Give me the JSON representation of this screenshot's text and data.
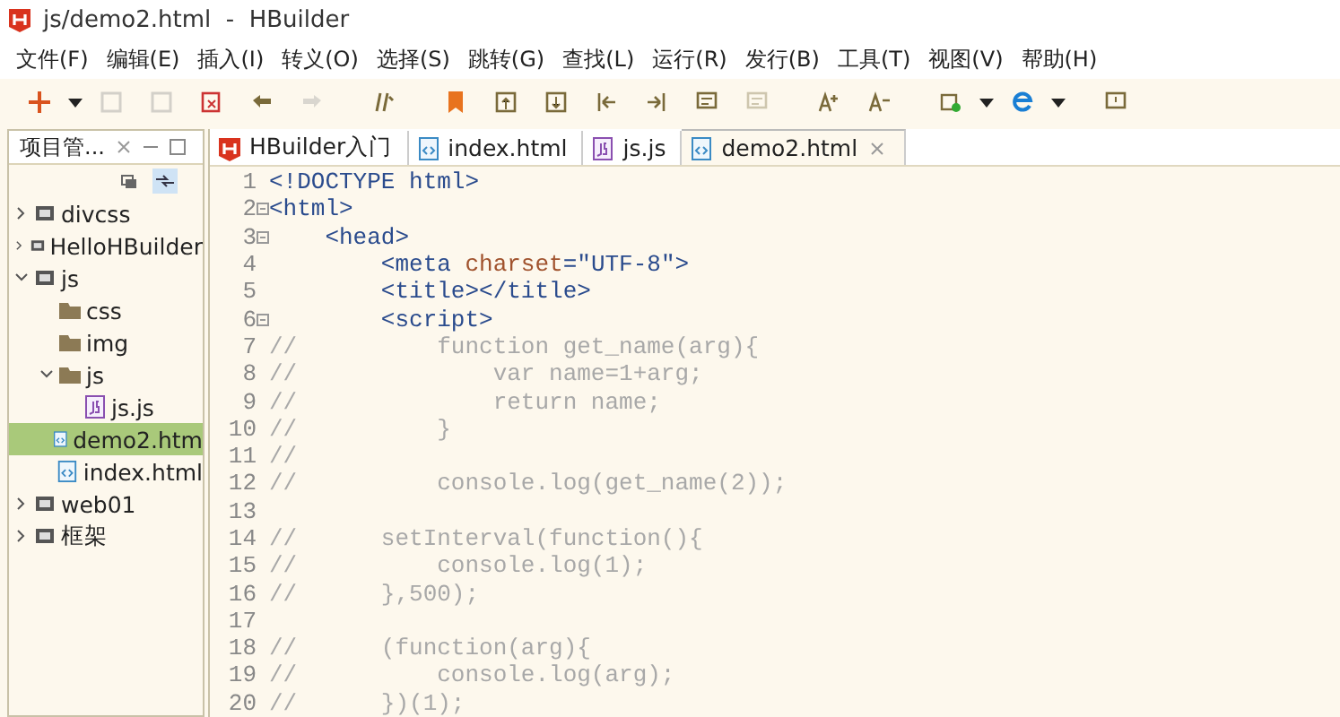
{
  "window": {
    "title": "js/demo2.html  -  HBuilder"
  },
  "menu": [
    "文件(F)",
    "编辑(E)",
    "插入(I)",
    "转义(O)",
    "选择(S)",
    "跳转(G)",
    "查找(L)",
    "运行(R)",
    "发行(B)",
    "工具(T)",
    "视图(V)",
    "帮助(H)"
  ],
  "toolbar": [
    {
      "kind": "new",
      "disabled": false
    },
    {
      "kind": "save",
      "disabled": true
    },
    {
      "kind": "save-all",
      "disabled": true
    },
    {
      "kind": "close-all",
      "disabled": false
    },
    {
      "kind": "undo",
      "disabled": false
    },
    {
      "kind": "redo",
      "disabled": true
    },
    {
      "kind": "format",
      "disabled": false
    },
    {
      "kind": "bookmark",
      "disabled": false
    },
    {
      "kind": "up",
      "disabled": false
    },
    {
      "kind": "down",
      "disabled": false
    },
    {
      "kind": "indent-left",
      "disabled": false
    },
    {
      "kind": "indent-right",
      "disabled": false
    },
    {
      "kind": "comment",
      "disabled": false
    },
    {
      "kind": "uncomment",
      "disabled": true
    },
    {
      "kind": "font-up",
      "disabled": false
    },
    {
      "kind": "font-down",
      "disabled": false
    },
    {
      "kind": "run",
      "disabled": false
    },
    {
      "kind": "browser",
      "disabled": false
    },
    {
      "kind": "feedback",
      "disabled": false
    }
  ],
  "sidebar": {
    "title": "项目管...",
    "items": [
      {
        "label": "divcss",
        "kind": "project",
        "expanded": false,
        "selected": false
      },
      {
        "label": "HelloHBuilder",
        "kind": "project",
        "expanded": false,
        "selected": false
      },
      {
        "label": "js",
        "kind": "project",
        "expanded": true,
        "selected": false,
        "children": [
          {
            "label": "css",
            "kind": "folder",
            "selected": false
          },
          {
            "label": "img",
            "kind": "folder",
            "selected": false
          },
          {
            "label": "js",
            "kind": "folder",
            "expanded": true,
            "selected": false,
            "children": [
              {
                "label": "js.js",
                "kind": "js",
                "selected": false
              }
            ]
          },
          {
            "label": "demo2.htm",
            "kind": "html",
            "selected": true
          },
          {
            "label": "index.html",
            "kind": "html",
            "selected": false
          }
        ]
      },
      {
        "label": "web01",
        "kind": "project",
        "expanded": false,
        "selected": false
      },
      {
        "label": "框架",
        "kind": "project",
        "expanded": false,
        "selected": false
      }
    ]
  },
  "tabs": [
    {
      "label": "HBuilder入门",
      "kind": "hbuilder",
      "selected": false
    },
    {
      "label": "index.html",
      "kind": "html",
      "selected": false
    },
    {
      "label": "js.js",
      "kind": "js",
      "selected": false
    },
    {
      "label": "demo2.html",
      "kind": "html",
      "selected": true
    }
  ],
  "code": [
    {
      "num": "1",
      "fold": false,
      "segments": [
        {
          "kind": "tag",
          "text": "<!DOCTYPE html>"
        }
      ]
    },
    {
      "num": "2",
      "fold": true,
      "segments": [
        {
          "kind": "tag",
          "text": "<html>"
        }
      ]
    },
    {
      "num": "3",
      "fold": true,
      "segments": [
        {
          "kind": "tag",
          "text": "    <head>"
        }
      ]
    },
    {
      "num": "4",
      "fold": false,
      "segments": [
        {
          "kind": "tag",
          "text": "        <meta"
        },
        {
          "kind": "attr",
          "text": " charset"
        },
        {
          "kind": "tag",
          "text": "="
        },
        {
          "kind": "string",
          "text": "\"UTF-8\""
        },
        {
          "kind": "tag",
          "text": ">"
        }
      ]
    },
    {
      "num": "5",
      "fold": false,
      "segments": [
        {
          "kind": "tag",
          "text": "        <title></title>"
        }
      ]
    },
    {
      "num": "6",
      "fold": true,
      "segments": [
        {
          "kind": "tag",
          "text": "        <script>"
        }
      ]
    },
    {
      "num": "7",
      "fold": false,
      "segments": [
        {
          "kind": "comment",
          "text": "//          function get_name(arg){"
        }
      ]
    },
    {
      "num": "8",
      "fold": false,
      "segments": [
        {
          "kind": "comment",
          "text": "//              var name=1+arg;"
        }
      ]
    },
    {
      "num": "9",
      "fold": false,
      "segments": [
        {
          "kind": "comment",
          "text": "//              return name;"
        }
      ]
    },
    {
      "num": "10",
      "fold": false,
      "segments": [
        {
          "kind": "comment",
          "text": "//          }"
        }
      ]
    },
    {
      "num": "11",
      "fold": false,
      "segments": [
        {
          "kind": "comment",
          "text": "//"
        }
      ]
    },
    {
      "num": "12",
      "fold": false,
      "segments": [
        {
          "kind": "comment",
          "text": "//          console.log(get_name(2));"
        }
      ]
    },
    {
      "num": "13",
      "fold": false
    },
    {
      "num": "14",
      "fold": false,
      "segments": [
        {
          "kind": "comment",
          "text": "//      setInterval(function(){"
        }
      ]
    },
    {
      "num": "15",
      "fold": false,
      "segments": [
        {
          "kind": "comment",
          "text": "//          console.log(1);"
        }
      ]
    },
    {
      "num": "16",
      "fold": false,
      "segments": [
        {
          "kind": "comment",
          "text": "//      },500);"
        }
      ]
    },
    {
      "num": "17",
      "fold": false
    },
    {
      "num": "18",
      "fold": false,
      "segments": [
        {
          "kind": "comment",
          "text": "//      (function(arg){"
        }
      ]
    },
    {
      "num": "19",
      "fold": false,
      "segments": [
        {
          "kind": "comment",
          "text": "//          console.log(arg);"
        }
      ]
    },
    {
      "num": "20",
      "fold": false,
      "segments": [
        {
          "kind": "comment",
          "text": "//      })(1);"
        }
      ]
    }
  ]
}
